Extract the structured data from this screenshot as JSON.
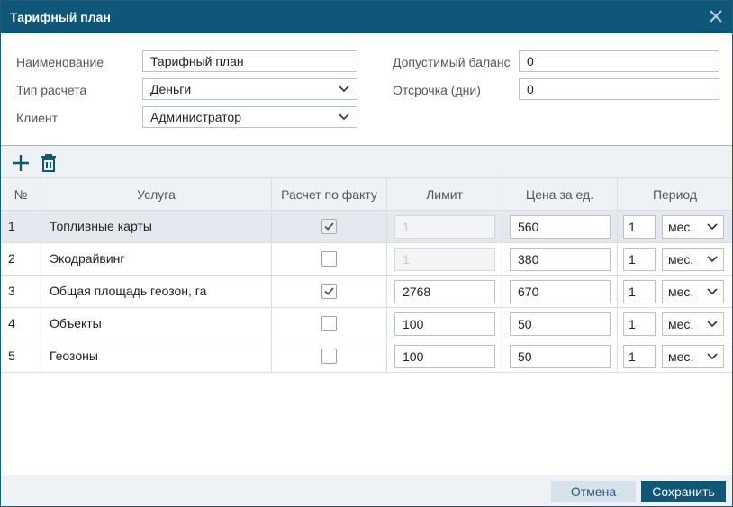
{
  "dialog": {
    "title": "Тарифный план"
  },
  "form": {
    "name_label": "Наименование",
    "name_value": "Тарифный план",
    "calc_type_label": "Тип расчета",
    "calc_type_value": "Деньги",
    "client_label": "Клиент",
    "client_value": "Администратор",
    "balance_label": "Допустимый баланс",
    "balance_value": "0",
    "delay_label": "Отсрочка (дни)",
    "delay_value": "0"
  },
  "table": {
    "headers": {
      "num": "№",
      "service": "Услуга",
      "by_fact": "Расчет по факту",
      "limit": "Лимит",
      "price": "Цена за ед.",
      "period": "Период"
    },
    "rows": [
      {
        "num": "1",
        "service": "Топливные карты",
        "by_fact": true,
        "by_fact_disabled": true,
        "limit": "1",
        "limit_disabled": true,
        "price": "560",
        "period_count": "1",
        "period_unit": "мес.",
        "selected": true
      },
      {
        "num": "2",
        "service": "Экодрайвинг",
        "by_fact": false,
        "by_fact_disabled": false,
        "limit": "1",
        "limit_disabled": true,
        "price": "380",
        "period_count": "1",
        "period_unit": "мес.",
        "selected": false
      },
      {
        "num": "3",
        "service": "Общая площадь геозон, га",
        "by_fact": true,
        "by_fact_disabled": false,
        "limit": "2768",
        "limit_disabled": false,
        "price": "670",
        "period_count": "1",
        "period_unit": "мес.",
        "selected": false
      },
      {
        "num": "4",
        "service": "Объекты",
        "by_fact": false,
        "by_fact_disabled": false,
        "limit": "100",
        "limit_disabled": false,
        "price": "50",
        "period_count": "1",
        "period_unit": "мес.",
        "selected": false
      },
      {
        "num": "5",
        "service": "Геозоны",
        "by_fact": false,
        "by_fact_disabled": false,
        "limit": "100",
        "limit_disabled": false,
        "price": "50",
        "period_count": "1",
        "period_unit": "мес.",
        "selected": false
      }
    ]
  },
  "footer": {
    "cancel_label": "Отмена",
    "save_label": "Сохранить"
  },
  "colors": {
    "accent": "#0f5778",
    "header_bg": "#eef2f5"
  },
  "icons": {
    "close": "close-icon",
    "add": "plus-icon",
    "delete": "trash-icon",
    "dropdown": "chevron-down-icon",
    "check": "check-icon"
  }
}
